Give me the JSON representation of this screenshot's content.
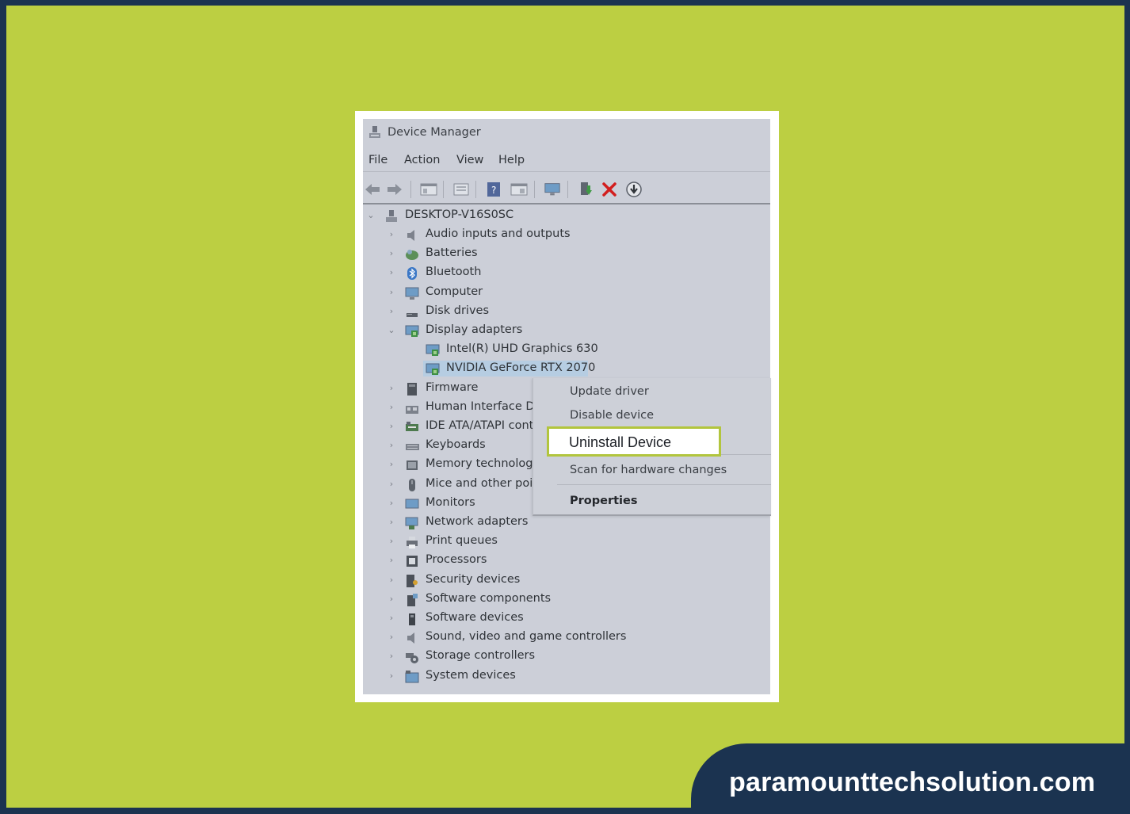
{
  "window": {
    "title": "Device Manager"
  },
  "menu": [
    "File",
    "Action",
    "View",
    "Help"
  ],
  "toolbar": {
    "icons": [
      "back-arrow-icon",
      "forward-arrow-icon",
      "show-hide-tree-icon",
      "properties-icon",
      "help-icon",
      "view-icon",
      "monitor-icon",
      "update-driver-icon",
      "uninstall-x-icon",
      "download-icon"
    ]
  },
  "tree": {
    "root": "DESKTOP-V16S0SC",
    "items": [
      {
        "label": "Audio inputs and outputs",
        "icon": "speaker-icon"
      },
      {
        "label": "Batteries",
        "icon": "battery-icon"
      },
      {
        "label": "Bluetooth",
        "icon": "bluetooth-icon"
      },
      {
        "label": "Computer",
        "icon": "computer-icon"
      },
      {
        "label": "Disk drives",
        "icon": "disk-drive-icon"
      },
      {
        "label": "Display adapters",
        "icon": "display-adapter-icon",
        "expanded": true
      },
      {
        "label": "Intel(R) UHD Graphics 630",
        "icon": "display-adapter-icon",
        "child": true
      },
      {
        "label": "NVIDIA GeForce RTX 2070",
        "icon": "display-adapter-icon",
        "child": true,
        "selected": true
      },
      {
        "label": "Firmware",
        "icon": "firmware-icon"
      },
      {
        "label": "Human Interface De",
        "icon": "hid-icon"
      },
      {
        "label": "IDE ATA/ATAPI contr",
        "icon": "ide-controller-icon"
      },
      {
        "label": "Keyboards",
        "icon": "keyboard-icon"
      },
      {
        "label": "Memory technolog",
        "icon": "memory-icon"
      },
      {
        "label": "Mice and other poi",
        "icon": "mouse-icon"
      },
      {
        "label": "Monitors",
        "icon": "monitor-icon"
      },
      {
        "label": "Network adapters",
        "icon": "network-icon"
      },
      {
        "label": "Print queues",
        "icon": "printer-icon"
      },
      {
        "label": "Processors",
        "icon": "processor-icon"
      },
      {
        "label": "Security devices",
        "icon": "security-icon"
      },
      {
        "label": "Software components",
        "icon": "software-component-icon"
      },
      {
        "label": "Software devices",
        "icon": "software-device-icon"
      },
      {
        "label": "Sound, video and game controllers",
        "icon": "speaker-icon"
      },
      {
        "label": "Storage controllers",
        "icon": "storage-icon"
      },
      {
        "label": "System devices",
        "icon": "system-icon"
      }
    ]
  },
  "context_menu": {
    "update": "Update driver",
    "disable": "Disable device",
    "uninstall": "Uninstall Device",
    "scan": "Scan for hardware changes",
    "properties": "Properties"
  },
  "footer": {
    "site": "paramounttechsolution.com"
  },
  "colors": {
    "background": "#bccf42",
    "border": "#1b3350",
    "highlight": "#b2c53d"
  }
}
